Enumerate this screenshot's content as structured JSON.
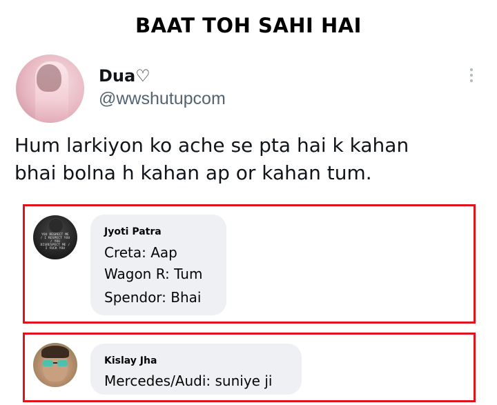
{
  "meme": {
    "title": "BAAT TOH SAHI HAI"
  },
  "tweet": {
    "display_name": "Dua♡",
    "handle": "@wwshutupcom",
    "text_lines": [
      "Hum larkiyon ko ache se pta hai k kahan",
      "bhai bolna h kahan ap or kahan tum."
    ],
    "avatar_icon": "profile-photo",
    "more_icon": "more-vertical-icon"
  },
  "comments": [
    {
      "author": "Jyoti Patra",
      "avatar_text": "YOU RESPECT ME / I RESPECT YOU / YOU DISRESPECT ME / I FUCK YOU",
      "lines": [
        "Creta: Aap",
        "Wagon R: Tum",
        "Spendor: Bhai"
      ]
    },
    {
      "author": "Kislay Jha",
      "lines": [
        "Mercedes/Audi: suniye ji"
      ]
    }
  ],
  "colors": {
    "highlight_border": "#e0121c",
    "bubble_bg": "#eef0f3",
    "handle_text": "#536471"
  }
}
